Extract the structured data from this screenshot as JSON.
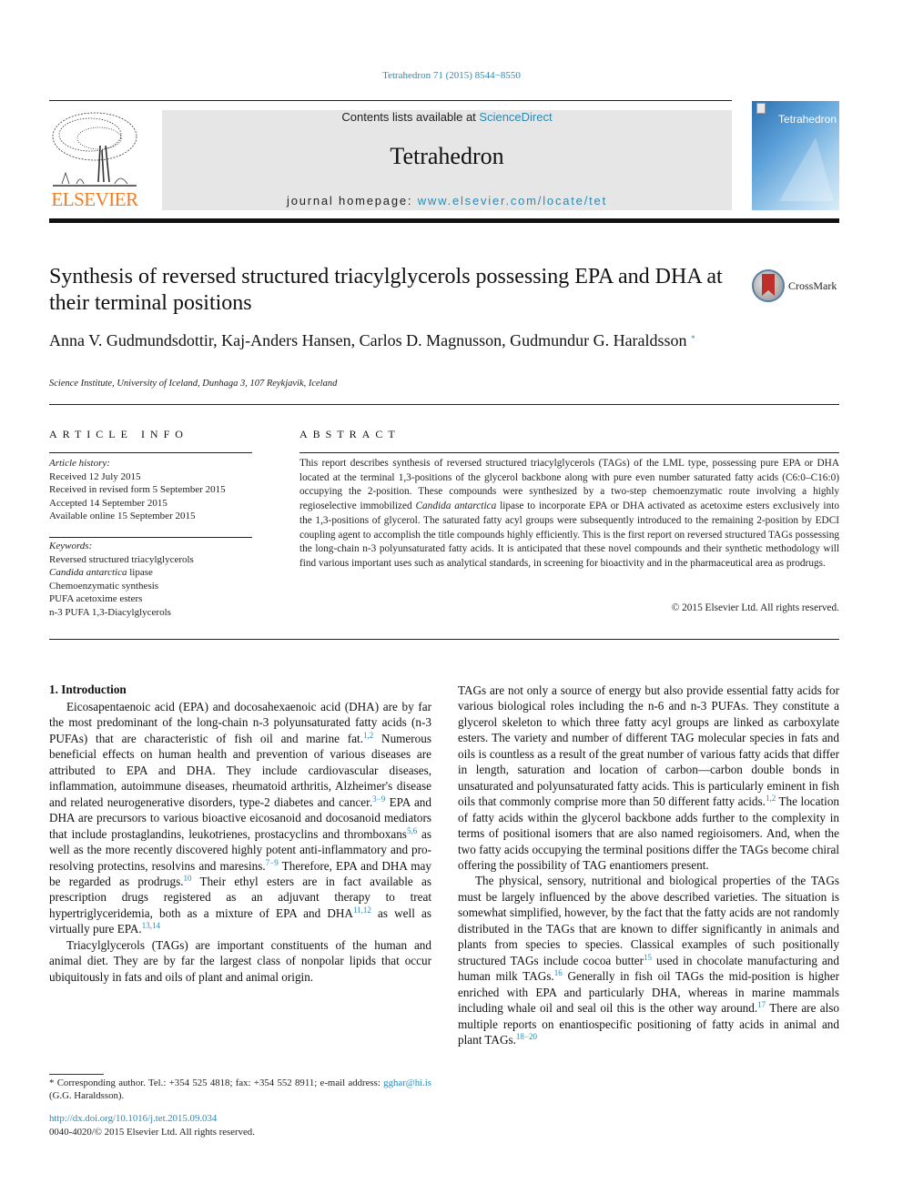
{
  "header": {
    "citation": "Tetrahedron 71 (2015) 8544−8550",
    "publisher_logo_text": "ELSEVIER",
    "contents_prefix": "Contents lists available at ",
    "contents_link": "ScienceDirect",
    "journal_title": "Tetrahedron",
    "homepage_prefix": "journal homepage: ",
    "homepage_link": "www.elsevier.com/locate/tet",
    "cover_title": "Tetrahedron",
    "crossmark_label": "CrossMark"
  },
  "article": {
    "title": "Synthesis of reversed structured triacylglycerols possessing EPA and DHA at their terminal positions",
    "authors": "Anna V. Gudmundsdottir, Kaj-Anders Hansen, Carlos D. Magnusson, Gudmundur G. Haraldsson",
    "corresponding_mark": "*",
    "affiliation": "Science Institute, University of Iceland, Dunhaga 3, 107 Reykjavik, Iceland"
  },
  "article_info": {
    "heading": "ARTICLE INFO",
    "history_label": "Article history:",
    "history": [
      "Received 12 July 2015",
      "Received in revised form 5 September 2015",
      "Accepted 14 September 2015",
      "Available online 15 September 2015"
    ],
    "keywords_label": "Keywords:",
    "keywords": [
      {
        "italic": "",
        "text": "Reversed structured triacylglycerols"
      },
      {
        "italic": "Candida antarctica",
        "text": " lipase"
      },
      {
        "italic": "",
        "text": "Chemoenzymatic synthesis"
      },
      {
        "italic": "",
        "text": "PUFA acetoxime esters"
      },
      {
        "italic": "",
        "text": "n-3 PUFA 1,3-Diacylglycerols"
      }
    ]
  },
  "abstract": {
    "heading": "ABSTRACT",
    "part1": "This report describes synthesis of reversed structured triacylglycerols (TAGs) of the LML type, possessing pure EPA or DHA located at the terminal 1,3-positions of the glycerol backbone along with pure even number saturated fatty acids (C6:0–C16:0) occupying the 2-position. These compounds were synthesized by a two-step chemoenzymatic route involving a highly regioselective immobilized ",
    "italic": "Candida antarctica",
    "part2": " lipase to incorporate EPA or DHA activated as acetoxime esters exclusively into the 1,3-positions of glycerol. The saturated fatty acyl groups were subsequently introduced to the remaining 2-position by EDCI coupling agent to accomplish the title compounds highly efficiently. This is the first report on reversed structured TAGs possessing the long-chain n-3 polyunsaturated fatty acids. It is anticipated that these novel compounds and their synthetic methodology will find various important uses such as analytical standards, in screening for bioactivity and in the pharmaceutical area as prodrugs.",
    "copyright": "© 2015 Elsevier Ltd. All rights reserved."
  },
  "introduction": {
    "heading": "1.  Introduction",
    "p1": [
      {
        "t": "Eicosapentaenoic acid (EPA) and docosahexaenoic acid (DHA) are by far the most predominant of the long-chain n-3 polyunsaturated fatty acids (n-3 PUFAs) that are characteristic of fish oil and marine fat.",
        "ref": "1,2"
      },
      {
        "t": " Numerous beneficial effects on human health and prevention of various diseases are attributed to EPA and DHA. They include cardiovascular diseases, inflammation, autoimmune diseases, rheumatoid arthritis, Alzheimer's disease and related neurogenerative disorders, type-2 diabetes and cancer.",
        "ref": "3−9"
      },
      {
        "t": " EPA and DHA are precursors to various bioactive eicosanoid and docosanoid mediators that include prostaglandins, leukotrienes, prostacyclins and thromboxans",
        "ref": "5,6"
      },
      {
        "t": " as well as the more recently discovered highly potent anti-inflammatory and pro-resolving protectins, resolvins and maresins.",
        "ref": "7−9"
      },
      {
        "t": " Therefore, EPA and DHA may be regarded as prodrugs.",
        "ref": "10"
      },
      {
        "t": " Their ethyl esters are in fact available as prescription drugs registered as an adjuvant therapy to treat hypertriglyceridemia, both as a mixture of EPA and DHA",
        "ref": "11,12"
      },
      {
        "t": " as well as virtually pure EPA.",
        "ref": "13,14"
      }
    ],
    "p2_left": "Triacylglycerols (TAGs) are important constituents of the human and animal diet. They are by far the largest class of nonpolar lipids that occur ubiquitously in fats and oils of plant and animal origin.",
    "p2_right": [
      {
        "t": "TAGs are not only a source of energy but also provide essential fatty acids for various biological roles including the n-6 and n-3 PUFAs. They constitute a glycerol skeleton to which three fatty acyl groups are linked as carboxylate esters. The variety and number of different TAG molecular species in fats and oils is countless as a result of the great number of various fatty acids that differ in length, saturation and location of carbon—carbon double bonds in unsaturated and polyunsaturated fatty acids. This is particularly eminent in fish oils that commonly comprise more than 50 different fatty acids.",
        "ref": "1,2"
      },
      {
        "t": " The location of fatty acids within the glycerol backbone adds further to the complexity in terms of positional isomers that are also named regioisomers. And, when the two fatty acids occupying the terminal positions differ the TAGs become chiral offering the possibility of TAG enantiomers present.",
        "ref": ""
      }
    ],
    "p3": [
      {
        "t": "The physical, sensory, nutritional and biological properties of the TAGs must be largely influenced by the above described varieties. The situation is somewhat simplified, however, by the fact that the fatty acids are not randomly distributed in the TAGs that are known to differ significantly in animals and plants from species to species. Classical examples of such positionally structured TAGs include cocoa butter",
        "ref": "15"
      },
      {
        "t": " used in chocolate manufacturing and human milk TAGs.",
        "ref": "16"
      },
      {
        "t": " Generally in fish oil TAGs the mid-position is higher enriched with EPA and particularly DHA, whereas in marine mammals including whale oil and seal oil this is the other way around.",
        "ref": "17"
      },
      {
        "t": " There are also multiple reports on enantiospecific positioning of fatty acids in animal and plant TAGs.",
        "ref": "18−20"
      }
    ]
  },
  "footer": {
    "footnote_prefix": "* Corresponding author. Tel.: +354 525 4818; fax: +354 552 8911; e-mail address: ",
    "footnote_email": "gghar@hi.is",
    "footnote_suffix": " (G.G. Haraldsson).",
    "doi": "http://dx.doi.org/10.1016/j.tet.2015.09.034",
    "issn": "0040-4020/© 2015 Elsevier Ltd. All rights reserved."
  }
}
